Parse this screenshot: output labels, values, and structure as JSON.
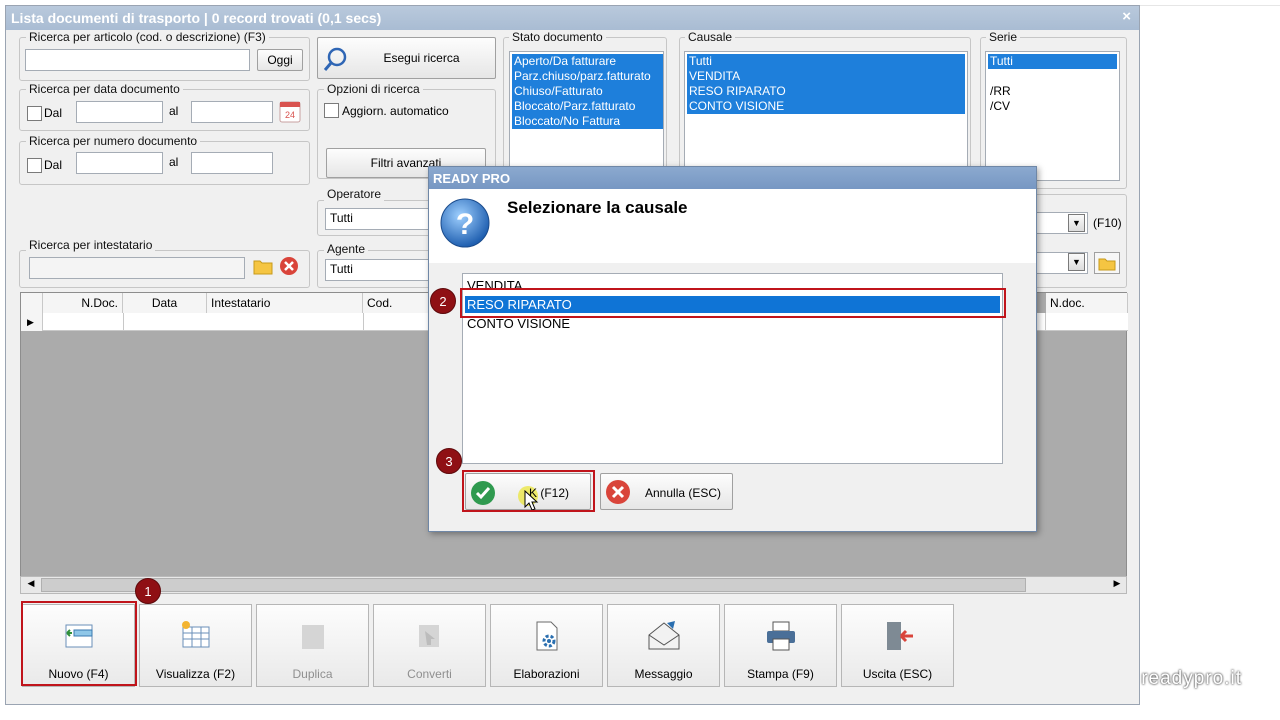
{
  "window": {
    "title": "Lista documenti di trasporto | 0 record trovati (0,1 secs)",
    "close": "×"
  },
  "search_article": {
    "label": "Ricerca per articolo (cod. o descrizione) (F3)",
    "value": "",
    "today_button": "Oggi"
  },
  "search_button": "Esegui ricerca",
  "search_date": {
    "label": "Ricerca per data documento",
    "from_label": "Dal",
    "to_label": "al"
  },
  "search_number": {
    "label": "Ricerca per numero documento",
    "from_label": "Dal",
    "to_label": "al"
  },
  "search_options": {
    "label": "Opzioni di ricerca",
    "auto_update": "Aggiorn. automatico",
    "advanced_filters": "Filtri avanzati"
  },
  "operator": {
    "label": "Operatore",
    "value": "Tutti"
  },
  "agent": {
    "label": "Agente",
    "value": "Tutti"
  },
  "search_holder": {
    "label": "Ricerca per intestatario",
    "value": ""
  },
  "stato_documento": {
    "label": "Stato documento",
    "items": [
      "Aperto/Da fatturare",
      "Parz.chiuso/parz.fatturato",
      "Chiuso/Fatturato",
      "Bloccato/Parz.fatturato",
      "Bloccato/No Fattura"
    ]
  },
  "causale": {
    "label": "Causale",
    "items": [
      "Tutti",
      "VENDITA",
      "RESO RIPARATO",
      "CONTO VISIONE"
    ]
  },
  "serie": {
    "label": "Serie",
    "items": [
      "Tutti",
      "",
      "/RR",
      "/CV"
    ]
  },
  "right_combo": {
    "shortcut": "(F10)"
  },
  "grid": {
    "columns": [
      "N.Doc.",
      "Data",
      "Intestatario",
      "Cod."
    ],
    "last_column": "N.doc."
  },
  "toolbar": [
    {
      "label": "Nuovo (F4)",
      "icon": "new-document-icon",
      "enabled": true
    },
    {
      "label": "Visualizza (F2)",
      "icon": "view-document-icon",
      "enabled": true
    },
    {
      "label": "Duplica",
      "icon": "duplicate-icon",
      "enabled": false
    },
    {
      "label": "Converti",
      "icon": "convert-icon",
      "enabled": false
    },
    {
      "label": "Elaborazioni",
      "icon": "processing-gear-icon",
      "enabled": true
    },
    {
      "label": "Messaggio",
      "icon": "message-icon",
      "enabled": true
    },
    {
      "label": "Stampa (F9)",
      "icon": "printer-icon",
      "enabled": true
    },
    {
      "label": "Uscita (ESC)",
      "icon": "exit-icon",
      "enabled": true
    }
  ],
  "dialog": {
    "title": "READY PRO",
    "message": "Selezionare la causale",
    "options": [
      "VENDITA",
      "RESO RIPARATO",
      "CONTO VISIONE"
    ],
    "selected": "RESO RIPARATO",
    "ok_button": "Ok (F12)",
    "ok_visible": "K (F12)",
    "cancel_button": "Annulla (ESC)"
  },
  "steps": [
    "1",
    "2",
    "3"
  ],
  "brand": "readypro.it",
  "colors": {
    "selection": "#1e7fdb",
    "highlight": "#c0141b",
    "badge": "#8f1014",
    "titlebar": "#a9bcd3"
  }
}
